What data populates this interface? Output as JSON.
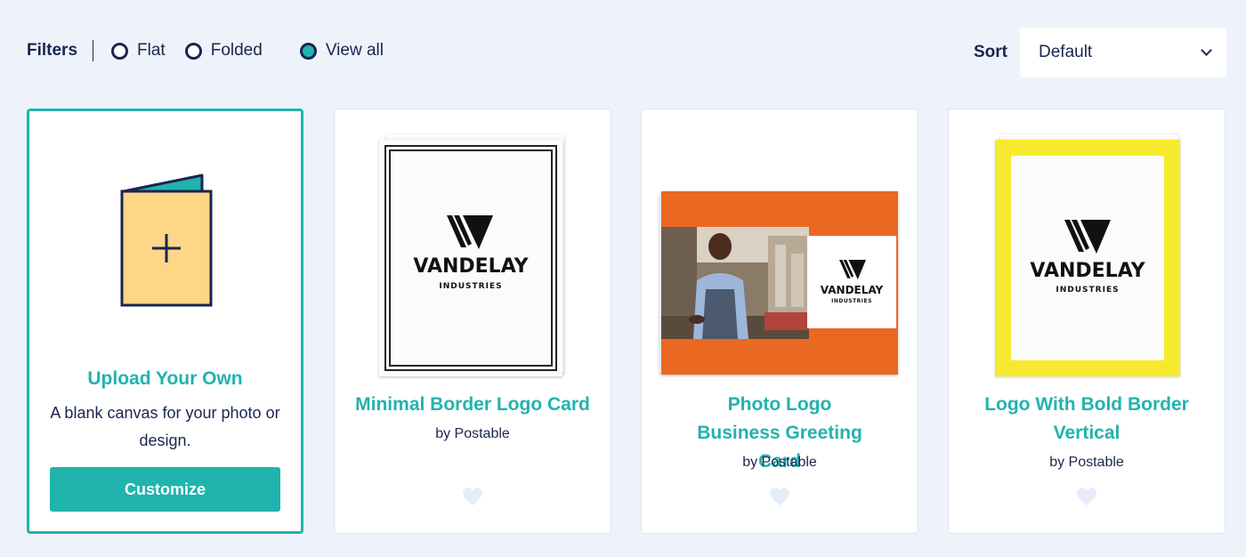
{
  "filters": {
    "label": "Filters",
    "options": [
      {
        "label": "Flat",
        "selected": false
      },
      {
        "label": "Folded",
        "selected": false
      },
      {
        "label": "View all",
        "selected": true
      }
    ]
  },
  "sort": {
    "label": "Sort",
    "value": "Default"
  },
  "upload_card": {
    "title": "Upload Your Own",
    "description": "A blank canvas for your photo or design.",
    "button_label": "Customize",
    "icon": "folded-card-plus-icon"
  },
  "cards": [
    {
      "title": "Minimal Border Logo Card",
      "byline": "by Postable",
      "logo_name": "VANDELAY",
      "logo_sub": "INDUSTRIES"
    },
    {
      "title": "Photo Logo Business Greeting Card",
      "byline": "by Postable",
      "logo_name": "VANDELAY",
      "logo_sub": "INDUSTRIES"
    },
    {
      "title": "Logo With Bold Border Vertical",
      "byline": "by Postable",
      "logo_name": "VANDELAY",
      "logo_sub": "INDUSTRIES"
    }
  ],
  "colors": {
    "accent": "#21b3ad",
    "text": "#1a2550",
    "background": "#eef3fb",
    "orange": "#ea6822",
    "yellow": "#f7ea2e",
    "heart": "#e6edf8"
  }
}
